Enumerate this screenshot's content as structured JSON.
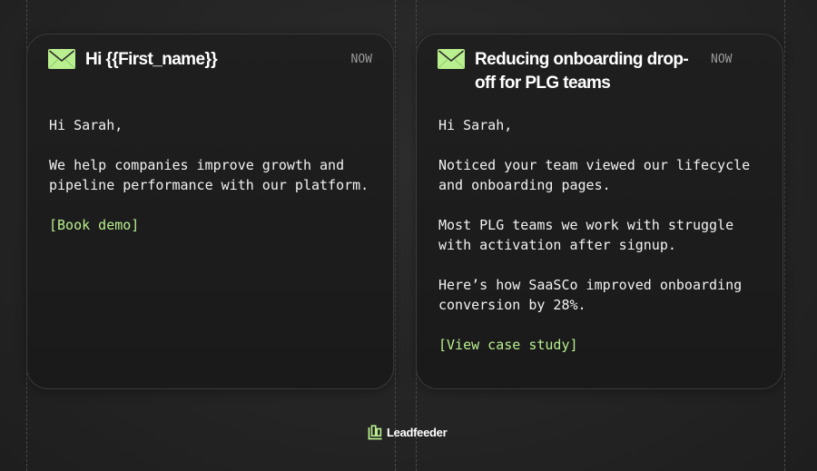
{
  "colors": {
    "accent": "#b9ef8f",
    "background": "#262626",
    "card": "#1c1c1c",
    "muted": "#9a9a9a"
  },
  "cards": [
    {
      "icon": "envelope-icon",
      "subject": "Hi {{First_name}}",
      "time": "NOW",
      "paragraphs": [
        "Hi Sarah,",
        "We help companies improve growth and pipeline performance with our platform."
      ],
      "cta": "[Book demo]"
    },
    {
      "icon": "envelope-icon",
      "subject": "Reducing onboarding drop-off for PLG teams",
      "time": "NOW",
      "paragraphs": [
        "Hi Sarah,",
        "Noticed your team viewed our lifecycle and onboarding pages.",
        "Most PLG teams we work with struggle with activation after signup.",
        "Here’s how SaaSCo improved onboarding conversion by 28%."
      ],
      "cta": "[View case study]"
    }
  ],
  "brand": {
    "icon": "leadfeeder-logo-icon",
    "name": "Leadfeeder"
  }
}
